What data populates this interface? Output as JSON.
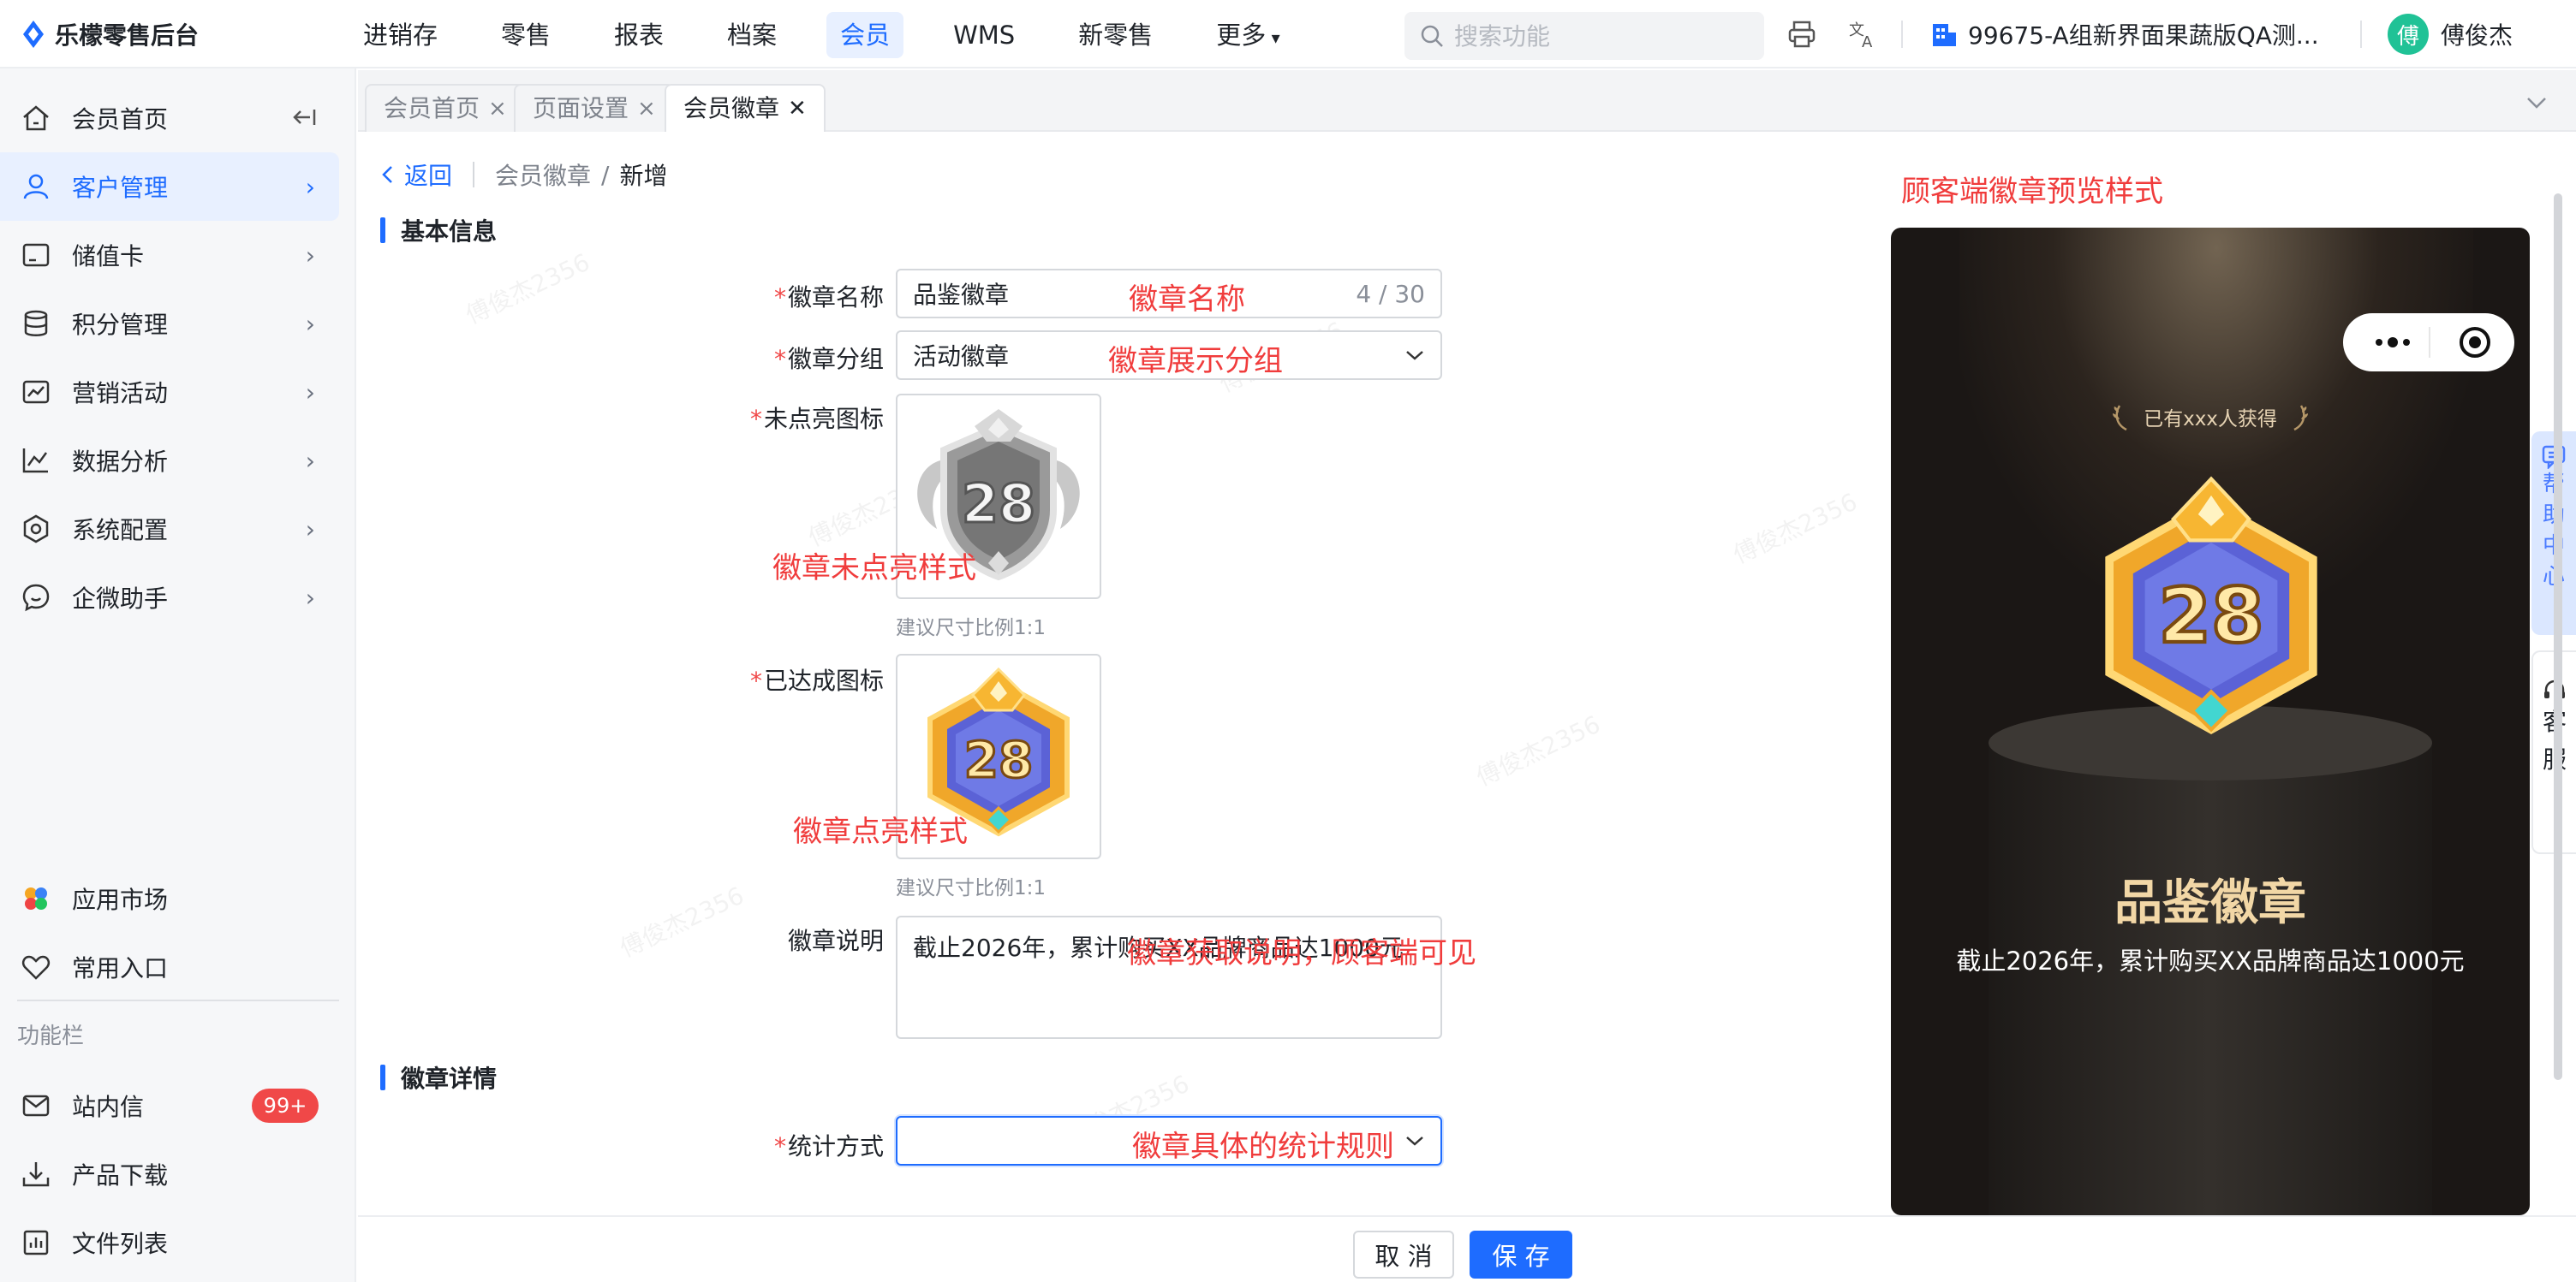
{
  "app": {
    "title": "乐檬零售后台"
  },
  "topnav": {
    "items": [
      {
        "label": "进销存"
      },
      {
        "label": "零售"
      },
      {
        "label": "报表"
      },
      {
        "label": "档案"
      },
      {
        "label": "会员"
      },
      {
        "label": "WMS"
      },
      {
        "label": "新零售"
      },
      {
        "label": "更多"
      }
    ],
    "active_index": 4,
    "search_placeholder": "搜索功能",
    "store": "99675-A组新界面果蔬版QA测...",
    "user_name": "傅俊杰",
    "user_initial": "傅"
  },
  "sidebar": {
    "items": [
      {
        "label": "会员首页",
        "icon": "home-icon"
      },
      {
        "label": "客户管理",
        "icon": "user-icon"
      },
      {
        "label": "储值卡",
        "icon": "card-icon"
      },
      {
        "label": "积分管理",
        "icon": "database-icon"
      },
      {
        "label": "营销活动",
        "icon": "chart-icon"
      },
      {
        "label": "数据分析",
        "icon": "line-chart-icon"
      },
      {
        "label": "系统配置",
        "icon": "settings-icon"
      },
      {
        "label": "企微助手",
        "icon": "chat-icon"
      }
    ],
    "bottom": [
      {
        "label": "应用市场",
        "icon": "app-market-icon"
      },
      {
        "label": "常用入口",
        "icon": "heart-icon"
      }
    ],
    "section_title": "功能栏",
    "tools": [
      {
        "label": "站内信",
        "icon": "mail-icon",
        "badge": "99+"
      },
      {
        "label": "产品下载",
        "icon": "download-icon"
      },
      {
        "label": "文件列表",
        "icon": "file-list-icon"
      }
    ],
    "active_index": 1
  },
  "tabs": [
    {
      "label": "会员首页"
    },
    {
      "label": "页面设置"
    },
    {
      "label": "会员徽章"
    }
  ],
  "breadcrumb": {
    "back": "返回",
    "parent": "会员徽章",
    "current": "新增"
  },
  "sections": {
    "basic": "基本信息",
    "detail": "徽章详情"
  },
  "form": {
    "name_label": "徽章名称",
    "name_value": "品鉴徽章",
    "name_count": "4 / 30",
    "group_label": "徽章分组",
    "group_value": "活动徽章",
    "unlit_label": "未点亮图标",
    "lit_label": "已达成图标",
    "size_hint": "建议尺寸比例1:1",
    "desc_label": "徽章说明",
    "desc_value": "截止2026年，累计购买XX品牌商品达1000元",
    "stat_label": "统计方式",
    "stat_value": "",
    "badge_number": "28"
  },
  "annotations": {
    "preview_title": "顾客端徽章预览样式",
    "name": "徽章名称",
    "group": "徽章展示分组",
    "unlit": "徽章未点亮样式",
    "lit": "徽章点亮样式",
    "desc": "徽章获取说明，顾客端可见",
    "stat": "徽章具体的统计规则"
  },
  "preview": {
    "earned": "已有xxx人获得",
    "name": "品鉴徽章",
    "desc": "截止2026年，累计购买XX品牌商品达1000元",
    "badge_number": "28"
  },
  "side_float": {
    "help": [
      "帮",
      "助",
      "中",
      "心"
    ],
    "service": [
      "客",
      "服"
    ]
  },
  "footer": {
    "cancel": "取 消",
    "save": "保 存"
  },
  "watermark": "傅俊杰2356",
  "colors": {
    "accent": "#1e6cff",
    "annotation": "#f03c3c",
    "required": "#f04848",
    "badge": "#f04848"
  }
}
